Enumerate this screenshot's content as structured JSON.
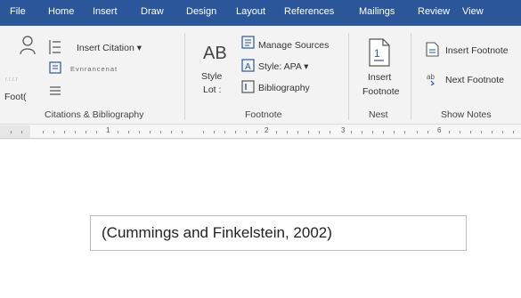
{
  "tabs": [
    "File",
    "Home",
    "Insert",
    "Draw",
    "Design",
    "Layout",
    "References",
    "Mailings",
    "Review",
    "View"
  ],
  "citations": {
    "insert_citation": "Insert Citation",
    "garbled": "Evnrancenat",
    "foot_label": "Foot(",
    "faded_label": "r.r.r.r",
    "group_title": "Citations & Bibliography"
  },
  "footnote_group": {
    "ab_label": "AB",
    "style_label": "Style",
    "lot_label": "Lot :",
    "manage_sources": "Manage Sources",
    "style_apa": "Style: APA",
    "bibliography": "Bibliography",
    "group_title": "Footnote"
  },
  "nest_group": {
    "insert": "Insert",
    "footnote": "Footnote",
    "group_title": "Nest"
  },
  "show_notes": {
    "insert_footnote": "Insert Footnote",
    "next_footnote": "Next Footnote",
    "group_title": "Show Notes"
  },
  "ruler_numbers": [
    "1",
    "2",
    "3",
    "6"
  ],
  "document": {
    "citation": "(Cummings and Finkelstein, 2002)"
  },
  "colors": {
    "tab_bar": "#2b579a",
    "ribbon_bg": "#f3f3f3",
    "icon_blue": "#2b579a"
  }
}
